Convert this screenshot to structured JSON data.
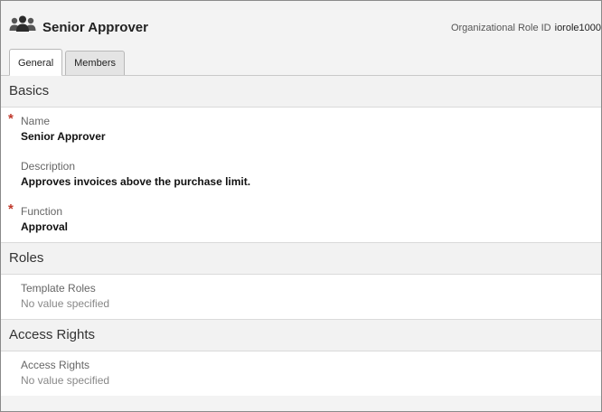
{
  "header": {
    "icon": "group-users-icon",
    "title": "Senior Approver",
    "role_id_label": "Organizational Role ID",
    "role_id_value": "iorole1000"
  },
  "tabs": [
    {
      "label": "General",
      "active": true
    },
    {
      "label": "Members",
      "active": false
    }
  ],
  "sections": {
    "basics": {
      "title": "Basics",
      "name": {
        "label": "Name",
        "value": "Senior Approver",
        "required": true
      },
      "description": {
        "label": "Description",
        "value": "Approves invoices above the purchase limit.",
        "required": false
      },
      "function": {
        "label": "Function",
        "value": "Approval",
        "required": true
      }
    },
    "roles": {
      "title": "Roles",
      "template_roles": {
        "label": "Template Roles",
        "value": "No value specified"
      }
    },
    "access_rights": {
      "title": "Access Rights",
      "access_rights": {
        "label": "Access Rights",
        "value": "No value specified"
      }
    }
  },
  "required_marker": "*",
  "colors": {
    "required": "#c0392b",
    "section_bg": "#f2f2f2",
    "header_bg": "#f3f3f3"
  }
}
